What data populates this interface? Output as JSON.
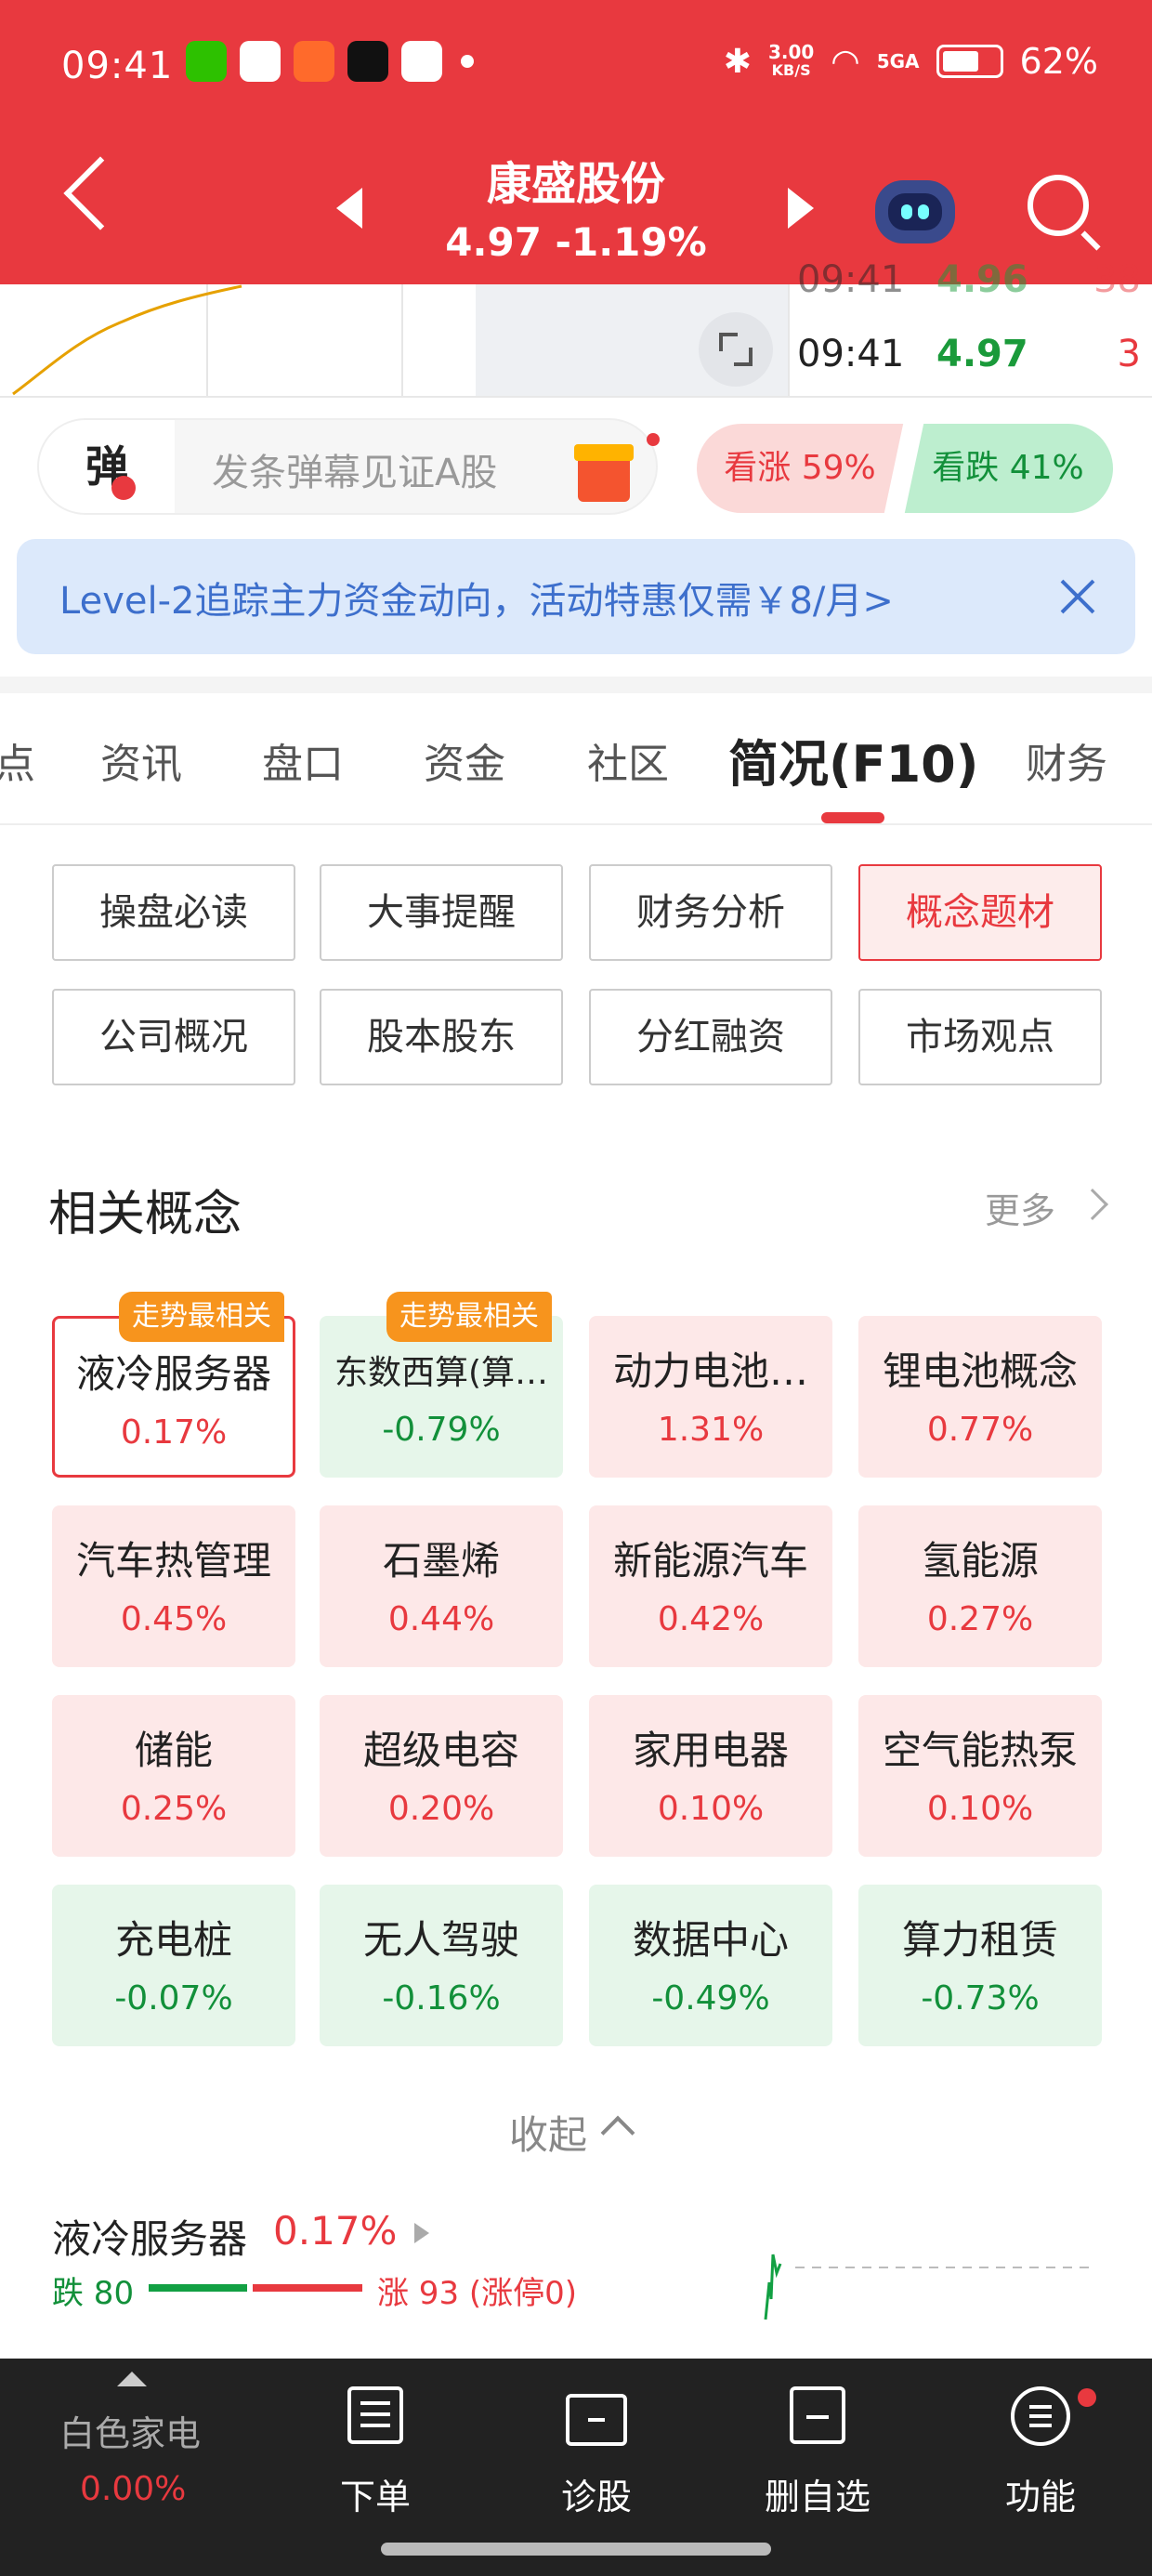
{
  "status_bar": {
    "time": "09:41",
    "net_speed_value": "3.00",
    "net_speed_unit": "KB/S",
    "signal": "5GA",
    "battery": "62%"
  },
  "header": {
    "title": "康盛股份",
    "price_change": "4.97 -1.19%"
  },
  "ticks": [
    {
      "time": "09:41",
      "price": "4.97",
      "vol": "3"
    }
  ],
  "danmu": {
    "badge": "弹",
    "placeholder": "发条弹幕见证A股"
  },
  "sentiment": {
    "up_label": "看涨 59%",
    "down_label": "看跌 41%",
    "up_pct": 59,
    "down_pct": 41
  },
  "banner": {
    "text": "Level-2追踪主力资金动向，活动特惠仅需￥8/月>"
  },
  "tabs": [
    {
      "label": "点"
    },
    {
      "label": "资讯"
    },
    {
      "label": "盘口"
    },
    {
      "label": "资金"
    },
    {
      "label": "社区"
    },
    {
      "label": "简况(F10)"
    },
    {
      "label": "财务"
    }
  ],
  "sub_buttons": [
    {
      "label": "操盘必读"
    },
    {
      "label": "大事提醒"
    },
    {
      "label": "财务分析"
    },
    {
      "label": "概念题材"
    },
    {
      "label": "公司概况"
    },
    {
      "label": "股本股东"
    },
    {
      "label": "分红融资"
    },
    {
      "label": "市场观点"
    }
  ],
  "related": {
    "title": "相关概念",
    "more": "更多",
    "tag": "走势最相关",
    "collapse": "收起",
    "concepts": [
      {
        "name": "液冷服务器",
        "pct": "0.17%",
        "trend": "up"
      },
      {
        "name": "东数西算(算…",
        "pct": "-0.79%",
        "trend": "down"
      },
      {
        "name": "动力电池…",
        "pct": "1.31%",
        "trend": "up"
      },
      {
        "name": "锂电池概念",
        "pct": "0.77%",
        "trend": "up"
      },
      {
        "name": "汽车热管理",
        "pct": "0.45%",
        "trend": "up"
      },
      {
        "name": "石墨烯",
        "pct": "0.44%",
        "trend": "up"
      },
      {
        "name": "新能源汽车",
        "pct": "0.42%",
        "trend": "up"
      },
      {
        "name": "氢能源",
        "pct": "0.27%",
        "trend": "up"
      },
      {
        "name": "储能",
        "pct": "0.25%",
        "trend": "up"
      },
      {
        "name": "超级电容",
        "pct": "0.20%",
        "trend": "up"
      },
      {
        "name": "家用电器",
        "pct": "0.10%",
        "trend": "up"
      },
      {
        "name": "空气能热泵",
        "pct": "0.10%",
        "trend": "up"
      },
      {
        "name": "充电桩",
        "pct": "-0.07%",
        "trend": "down"
      },
      {
        "name": "无人驾驶",
        "pct": "-0.16%",
        "trend": "down"
      },
      {
        "name": "数据中心",
        "pct": "-0.49%",
        "trend": "down"
      },
      {
        "name": "算力租赁",
        "pct": "-0.73%",
        "trend": "down"
      }
    ]
  },
  "concept_detail": {
    "name": "液冷服务器",
    "pct": "0.17%",
    "down": "跌 80",
    "up": "涨 93 (涨停0)"
  },
  "bottom_nav": {
    "index_name": "白色家电",
    "index_pct": "0.00%",
    "items": [
      {
        "label": "下单"
      },
      {
        "label": "诊股"
      },
      {
        "label": "删自选"
      },
      {
        "label": "功能"
      }
    ]
  },
  "colors": {
    "brand_red": "#e8393f",
    "up_red": "#e8393f",
    "down_green": "#12903a",
    "banner_blue": "#3d6fcc",
    "tag_orange": "#f7941d"
  }
}
